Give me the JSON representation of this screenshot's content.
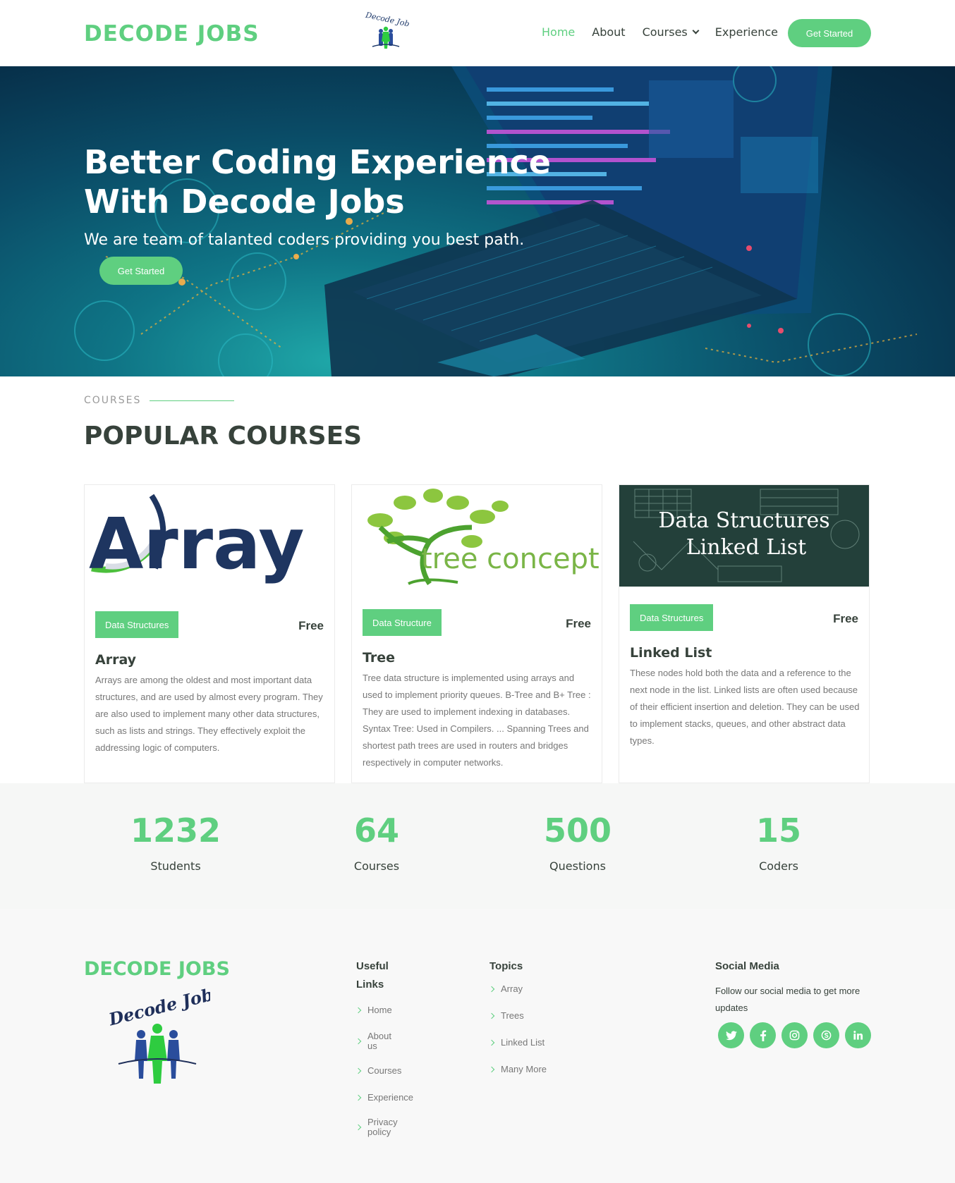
{
  "brand": {
    "name": "DECODE JOBS",
    "logo_script": "Decode Jobs"
  },
  "nav": {
    "items": [
      {
        "label": "Home"
      },
      {
        "label": "About"
      },
      {
        "label": "Courses"
      },
      {
        "label": "Experience"
      }
    ],
    "cta": "Get Started"
  },
  "hero": {
    "title_line1": "Better Coding Experience",
    "title_line2": "With Decode Jobs",
    "subtitle": "We are team of talanted coders providing you best path.",
    "cta": "Get Started"
  },
  "courses": {
    "tag": "COURSES",
    "title": "POPULAR COURSES",
    "cards": [
      {
        "image_text": "Array",
        "badge": "Data Structures",
        "price": "Free",
        "title": "Array",
        "desc": "Arrays are among the oldest and most important data structures, and are used by almost every program. They are also used to implement many other data structures, such as lists and strings. They effectively exploit the addressing logic of computers."
      },
      {
        "image_text": "tree concept",
        "badge": "Data Structure",
        "price": "Free",
        "title": "Tree",
        "desc": "Tree data structure is implemented using arrays and used to implement priority queues. B-Tree and B+ Tree : They are used to implement indexing in databases. Syntax Tree: Used in Compilers. ... Spanning Trees and shortest path trees are used in routers and bridges respectively in computer networks."
      },
      {
        "image_text_line1": "Data Structures",
        "image_text_line2": "Linked List",
        "badge": "Data Structures",
        "price": "Free",
        "title": "Linked List",
        "desc": "These nodes hold both the data and a reference to the next node in the list. Linked lists are often used because of their efficient insertion and deletion. They can be used to implement stacks, queues, and other abstract data types."
      }
    ]
  },
  "counts": [
    {
      "value": "1232",
      "label": "Students"
    },
    {
      "value": "64",
      "label": "Courses"
    },
    {
      "value": "500",
      "label": "Questions"
    },
    {
      "value": "15",
      "label": "Coders"
    }
  ],
  "footer": {
    "brand": "DECODE JOBS",
    "logo_script": "Decode Jobs",
    "useful_links": {
      "title_line1": "Useful",
      "title_line2": "Links",
      "items": [
        "Home",
        "About us",
        "Courses",
        "Experience",
        "Privacy policy"
      ]
    },
    "topics": {
      "title": "Topics",
      "items": [
        "Array",
        "Trees",
        "Linked List",
        "Many More"
      ]
    },
    "social": {
      "title": "Social Media",
      "text": "Follow our social media to get more updates",
      "icons": [
        "twitter-icon",
        "facebook-icon",
        "instagram-icon",
        "skype-icon",
        "linkedin-icon"
      ]
    }
  },
  "colors": {
    "accent": "#5fcf80",
    "heading": "#37423b",
    "muted": "#777777",
    "hero_dark": "#07304a"
  }
}
